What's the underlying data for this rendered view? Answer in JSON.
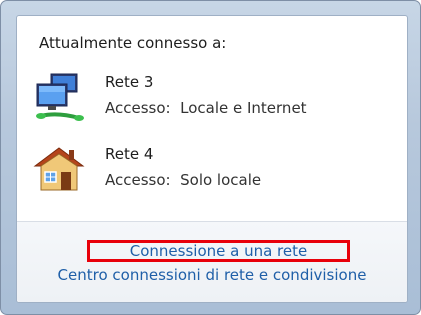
{
  "header": {
    "title": "Attualmente connesso a:"
  },
  "networks": [
    {
      "name": "Rete 3",
      "access": "Accesso:  Locale e Internet",
      "icon": "network-computer-icon"
    },
    {
      "name": "Rete 4",
      "access": "Accesso:  Solo locale",
      "icon": "home-network-icon"
    }
  ],
  "links": {
    "connect": "Connessione a una rete",
    "center": "Centro connessioni di rete e condivisione"
  },
  "colors": {
    "link": "#1f5fa8",
    "highlight_box": "#e8000a",
    "frame": "#b7c8dc"
  }
}
